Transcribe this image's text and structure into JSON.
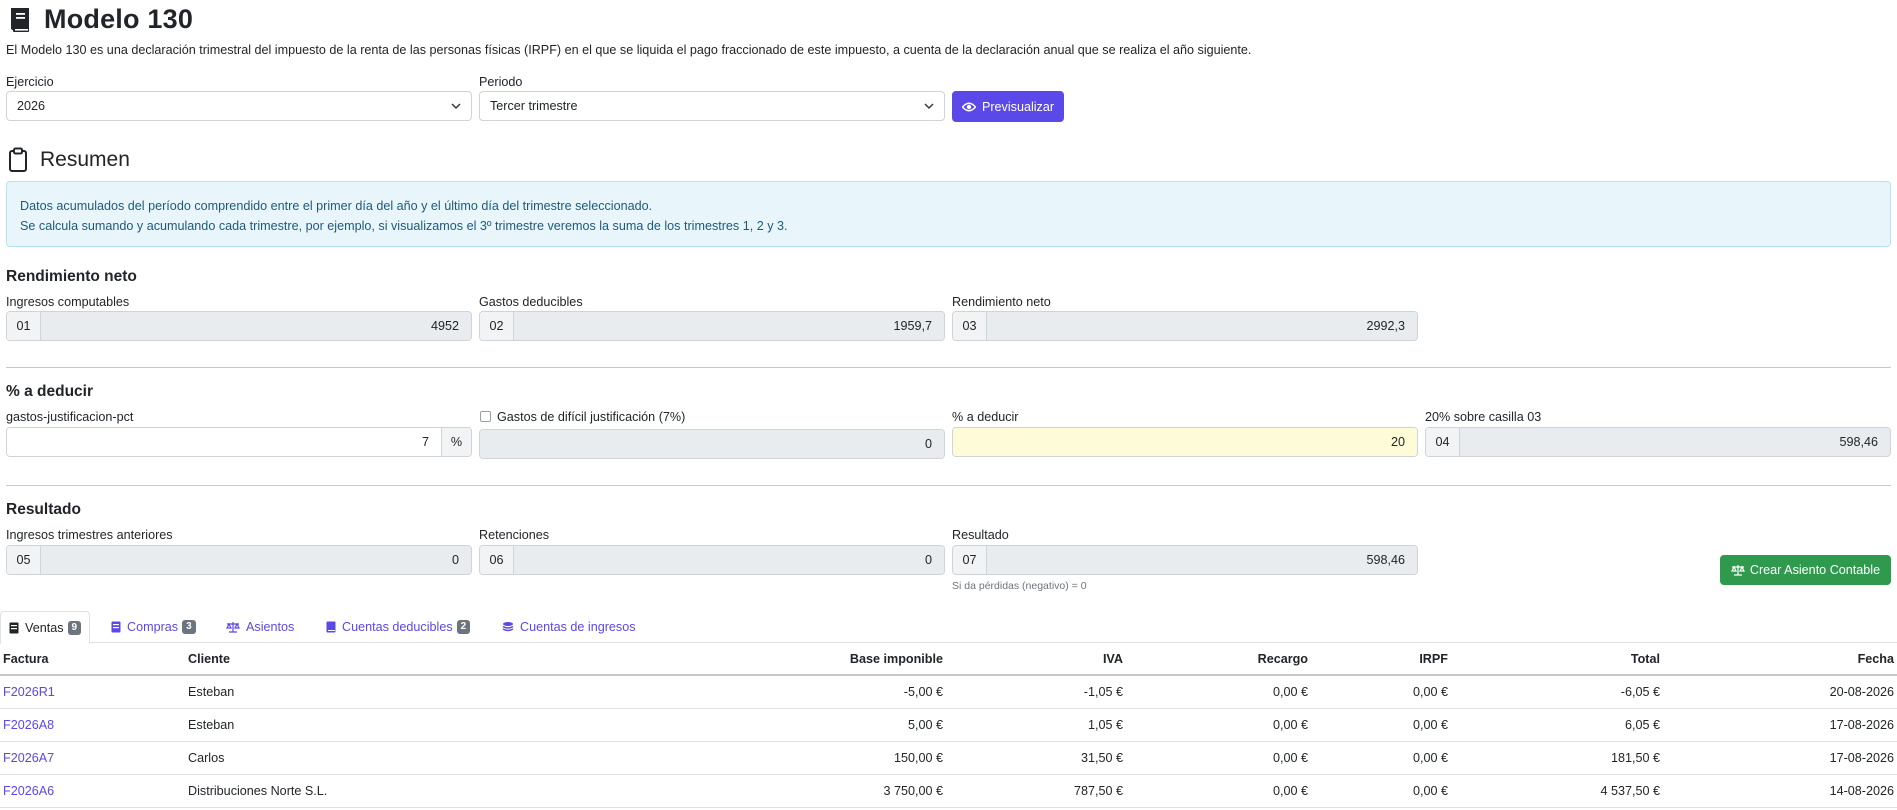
{
  "page": {
    "title": "Modelo 130",
    "title_icon": "book-icon",
    "intro": "El Modelo 130 es una declaración trimestral del impuesto de la renta de las personas físicas (IRPF) en el que se liquida el pago fraccionado de este impuesto, a cuenta de la declaración anual que se realiza el año siguiente."
  },
  "filters": {
    "ejercicio_label": "Ejercicio",
    "ejercicio_value": "2026",
    "periodo_label": "Periodo",
    "periodo_value": "Tercer trimestre",
    "preview_button": "Previsualizar",
    "preview_icon": "eye-icon"
  },
  "resumen": {
    "title": "Resumen",
    "icon": "clipboard-icon",
    "info_line1": "Datos acumulados del período comprendido entre el primer día del año y el último día del trimestre seleccionado.",
    "info_line2": "Se calcula sumando y acumulando cada trimestre, por ejemplo, si visualizamos el 3º trimestre veremos la suma de los trimestres 1, 2 y 3."
  },
  "rendimiento": {
    "title": "Rendimiento neto",
    "ingresos_label": "Ingresos computables",
    "ingresos_box": "01",
    "ingresos_value": "4952",
    "gastos_label": "Gastos deducibles",
    "gastos_box": "02",
    "gastos_value": "1959,7",
    "neto_label": "Rendimiento neto",
    "neto_box": "03",
    "neto_value": "2992,3"
  },
  "deducir": {
    "title": "% a deducir",
    "pct_label": "gastos-justificacion-pct",
    "pct_value": "7",
    "pct_suffix": "%",
    "dificil_label": "Gastos de difícil justificación (7%)",
    "dificil_value": "0",
    "pct_deducir_label": "% a deducir",
    "pct_deducir_value": "20",
    "casilla_label": "20% sobre casilla 03",
    "casilla_box": "04",
    "casilla_value": "598,46"
  },
  "resultado": {
    "title": "Resultado",
    "anteriores_label": "Ingresos trimestres anteriores",
    "anteriores_box": "05",
    "anteriores_value": "0",
    "retenciones_label": "Retenciones",
    "retenciones_box": "06",
    "retenciones_value": "0",
    "resultado_label": "Resultado",
    "resultado_box": "07",
    "resultado_value": "598,46",
    "note": "Si da pérdidas (negativo) = 0",
    "button": "Crear Asiento Contable",
    "button_icon": "scale-icon"
  },
  "tabs": [
    {
      "label": "Ventas",
      "badge": "9",
      "icon": "receipt-icon"
    },
    {
      "label": "Compras",
      "badge": "3",
      "icon": "invoice-icon"
    },
    {
      "label": "Asientos",
      "badge": "",
      "icon": "scale-icon"
    },
    {
      "label": "Cuentas deducibles",
      "badge": "2",
      "icon": "book-icon"
    },
    {
      "label": "Cuentas de ingresos",
      "badge": "",
      "icon": "coins-icon"
    }
  ],
  "table": {
    "columns": [
      "Factura",
      "Cliente",
      "Base imponible",
      "IVA",
      "Recargo",
      "IRPF",
      "Total",
      "Fecha"
    ],
    "rows": [
      [
        "F2026R1",
        "Esteban",
        "-5,00 €",
        "-1,05 €",
        "0,00 €",
        "0,00 €",
        "-6,05 €",
        "20-08-2026"
      ],
      [
        "F2026A8",
        "Esteban",
        "5,00 €",
        "1,05 €",
        "0,00 €",
        "0,00 €",
        "6,05 €",
        "17-08-2026"
      ],
      [
        "F2026A7",
        "Carlos",
        "150,00 €",
        "31,50 €",
        "0,00 €",
        "0,00 €",
        "181,50 €",
        "17-08-2026"
      ],
      [
        "F2026A6",
        "Distribuciones Norte S.L.",
        "3 750,00 €",
        "787,50 €",
        "0,00 €",
        "0,00 €",
        "4 537,50 €",
        "14-08-2026"
      ]
    ]
  },
  "colors": {
    "primary": "#5b48e8",
    "success": "#2f9a4e",
    "info_bg": "#e8f6fb",
    "highlight": "#fefbd8"
  }
}
